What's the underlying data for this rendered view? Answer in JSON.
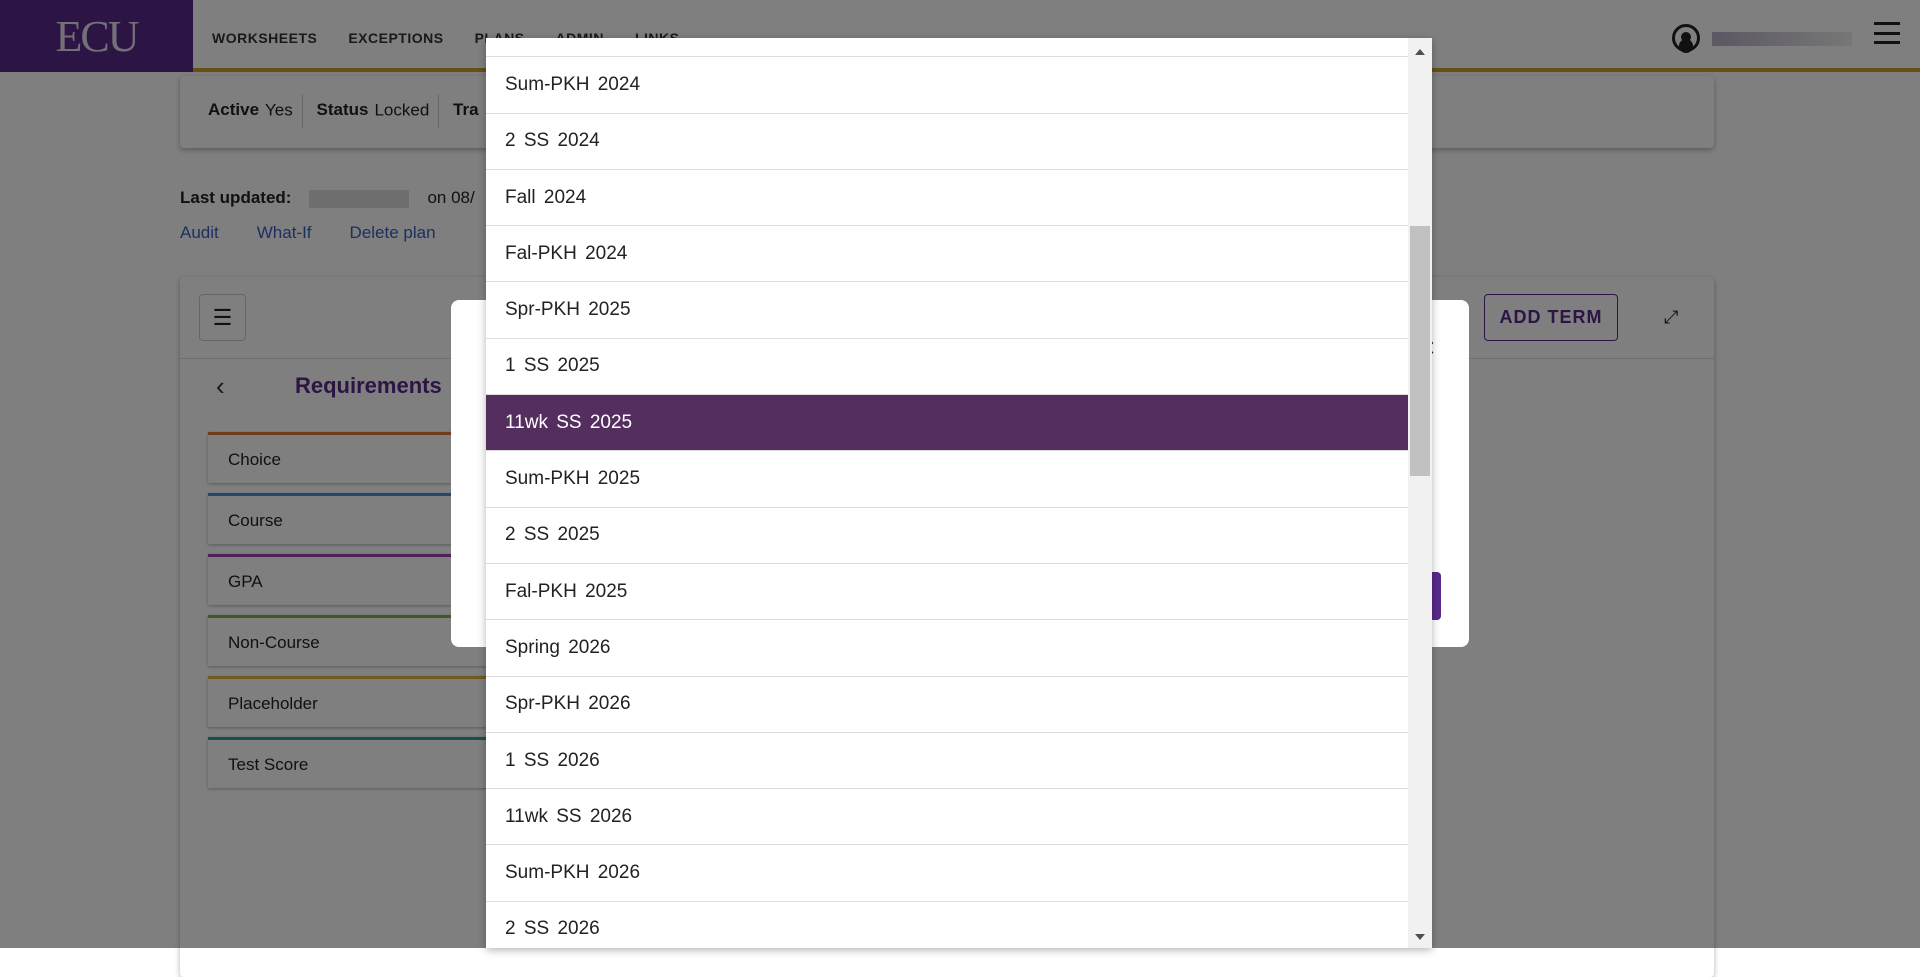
{
  "header": {
    "logo": "ECU",
    "nav": [
      "WORKSHEETS",
      "EXCEPTIONS",
      "PLANS",
      "ADMIN",
      "LINKS"
    ]
  },
  "info": {
    "active_label": "Active",
    "active_value": "Yes",
    "status_label": "Status",
    "status_value": "Locked",
    "third_label": "Tra"
  },
  "updated": {
    "label": "Last updated:",
    "date": "on 08/"
  },
  "links": [
    "Audit",
    "What-If",
    "Delete plan"
  ],
  "main": {
    "add_term": "ADD TERM",
    "requirements_title": "Requirements",
    "requirements": [
      {
        "label": "Choice",
        "color": "#e07b39"
      },
      {
        "label": "Course",
        "color": "#4a8fd8"
      },
      {
        "label": "GPA",
        "color": "#a040b0"
      },
      {
        "label": "Non-Course",
        "color": "#7cb342"
      },
      {
        "label": "Placeholder",
        "color": "#e5b93a"
      },
      {
        "label": "Test Score",
        "color": "#26a69a"
      }
    ]
  },
  "modal": {
    "close": "×"
  },
  "dropdown": {
    "selected": "11wk SS 2025",
    "options": [
      "",
      "Sum-PKH 2024",
      "2 SS 2024",
      "Fall 2024",
      "Fal-PKH 2024",
      "Spr-PKH 2025",
      "1 SS 2025",
      "11wk SS 2025",
      "Sum-PKH 2025",
      "2 SS 2025",
      "Fal-PKH 2025",
      "Spring 2026",
      "Spr-PKH 2026",
      "1 SS 2026",
      "11wk SS 2026",
      "Sum-PKH 2026",
      "2 SS 2026"
    ],
    "selected_color": "#552e60"
  }
}
